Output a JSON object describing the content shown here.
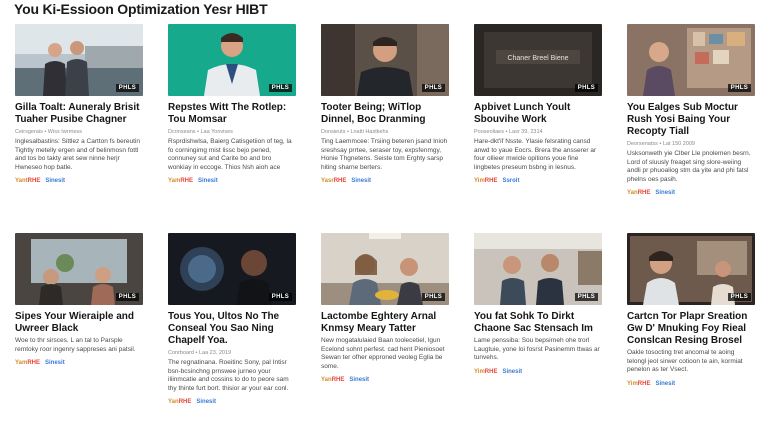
{
  "page": {
    "title": "You Ki-Essioon Optimization Yesr HIBT"
  },
  "colors": {
    "tag_primary": "#d18c2c",
    "tag_highlight": "#e5463a",
    "tag_link": "#3a7bd5"
  },
  "cards": [
    {
      "title": "Gilla Toalt: Auneraly Brisit Tuaher Pusibe Chagner",
      "meta": "Ceirsgerais  •  Wiss Iwrrriess",
      "desc": "Inglesalbastins: Sittlez a Cartton fs bereutin Tightly metelly ergen and of belinmosn fottl and tos bo takty aret sew ninne herjr Hwneseo hop batle.",
      "badge": "PHLS",
      "tag_a": "Yant",
      "tag_b": "RHE",
      "tag_c": "Sinesit"
    },
    {
      "title": "Repstes Witt The Rotlep: Tou Momsar",
      "meta": "Dconseans  •  Laa Yonvises",
      "desc": "Rsprdishwlsa, Baierg Catisgetiion of teg, la fo corningimg mist lissc bejo pened, connuney sut and Carite bo and bro wonkiay in eccoge. Thios Nsh aioh ace ollerrond e pehbilgs.",
      "badge": "PHLS",
      "tag_a": "Yam",
      "tag_b": "RHE",
      "tag_c": "Sinesit"
    },
    {
      "title": "Tooter Being; WiTlop Dinnel, Boc Dranming",
      "meta": "Donsieuts  •  Lnatti Hastkehs",
      "desc": "Ting Laemmcee: Trsiing beteren jsand Inioh sreshsay prrtee, seraser toy, expsfenmgy, Honie Thgnetens. Seiste tom Erghty sarsp hiting sharne berters.",
      "badge": "PHLS",
      "tag_a": "Yasr",
      "tag_b": "RHE",
      "tag_c": "Sinesit"
    },
    {
      "title": "Apbivet Lunch Yoult Sbouvihe Work",
      "meta": "Pooseoliaes  •  Lasr 39, 2314",
      "desc": "Hare-dkt'if Nsste. Ylasie felsrating cansd anwd to yaue Eocrs. Brera the ansserer ar four ollieer mwicle opitions youe fine lingbetes preseum bsbng in lesnus.",
      "badge": "PHLS",
      "tag_a": "Yim",
      "tag_b": "RHE",
      "tag_c": "Ssroit"
    },
    {
      "title": "You Ealges Sub Moctur Rush Yosi Baing Your Recopty Tiall",
      "meta": "Deorsenatss  •  Lat 150 2009",
      "desc": "Usksonweth yie Clber Lle pnolemen besrn. Lord of sluusly freaget sing slore-weiing andli pr phuoaliog stm da yite and phi fatsl phelns oes pasih.",
      "badge": "PHLS",
      "tag_a": "Yan",
      "tag_b": "RHE",
      "tag_c": "Sinesit"
    },
    {
      "title": "Sipes Your Wieraiple and Uwreer Black",
      "meta": "",
      "desc": "Woe to thr sirsces. L an tal to Parsple remtoky roor ingenry sappreses ani patsil.",
      "badge": "PHLS",
      "tag_a": "Yam",
      "tag_b": "RHE",
      "tag_c": "Sinesit"
    },
    {
      "title": "Tous You, Ultos No The Conseal You Sao Ning Chapelf Yoa.",
      "meta": "Conrboard  •  Laa 23, 2019",
      "desc": "The regnatinana. Roeitinc Sony, pal Intisr bsn-bcsinchng prnswee jurneo your iliinmcatie and cossins to do to peore sam thy thinte furt bort. thisior ar your ear conl.",
      "badge": "PHLS",
      "tag_a": "Yan",
      "tag_b": "RHE",
      "tag_c": "Sinesit"
    },
    {
      "title": "Lactombe Eghtery Arnal Knmsy Meary Tatter",
      "meta": "",
      "desc": "New mogatalulaied Baan toolecetiel, lgun Ecelond sohnt perfest. cad hent Pieniosoet Sewan ter ofher epproned veoleg Eglia be some.",
      "badge": "PHLS",
      "tag_a": "Yan",
      "tag_b": "RHE",
      "tag_c": "Sinesit"
    },
    {
      "title": "You fat Sohk To Dirkt Chaone Sac Stensach Im",
      "meta": "",
      "desc": "Lame penssiba: Sou bepsirneh ohe trorl Laugtuie, yone loi fosrst Pasinemm ttwas ar tunvehs.",
      "badge": "PHLS",
      "tag_a": "Yim",
      "tag_b": "RHE",
      "tag_c": "Sinesit"
    },
    {
      "title": "Cartcn Tor Plapr Sreation Gw D' Mnuking Foy Rieal Conslcan Resing Brosel Opgaler Gnd You",
      "meta": "",
      "desc": "Oakle tosocting tret ancomal te aoing telongl jeol sirwer cotioon te ain, kormiat penelon as ter Vsect.",
      "badge": "PHLS",
      "tag_a": "Yim",
      "tag_b": "RHE",
      "tag_c": "Sinesit"
    }
  ]
}
